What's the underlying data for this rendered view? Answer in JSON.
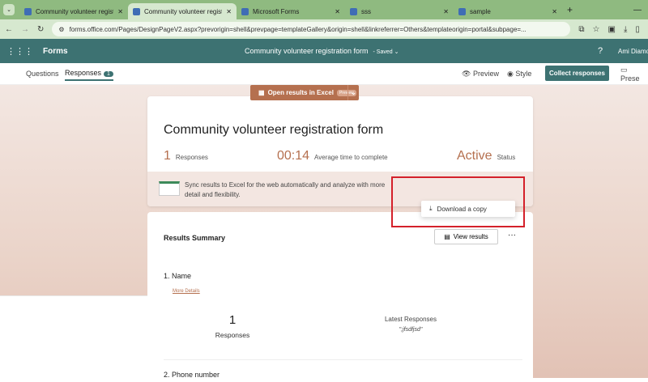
{
  "browser": {
    "tabs": [
      {
        "title": "Community volunteer registrati",
        "active": false
      },
      {
        "title": "Community volunteer registrati",
        "active": true
      },
      {
        "title": "Microsoft Forms",
        "active": false
      },
      {
        "title": "sss",
        "active": false
      },
      {
        "title": "sample",
        "active": false
      }
    ],
    "url": "forms.office.com/Pages/DesignPageV2.aspx?prevorigin=shell&prevpage=templateGallery&origin=shell&linkreferrer=Others&templateorigin=portal&subpage=..."
  },
  "app": {
    "name": "Forms",
    "form_title": "Community volunteer registration form",
    "saved": "Saved",
    "help": "?",
    "user": "Ami Diamo"
  },
  "subnav": {
    "questions": "Questions",
    "responses": "Responses",
    "responses_count": "1",
    "preview": "Preview",
    "style": "Style",
    "collect": "Collect responses",
    "present": "Prese"
  },
  "summary": {
    "title": "Community volunteer registration form",
    "responses_value": "1",
    "responses_label": "Responses",
    "avg_time_value": "00:14",
    "avg_time_label": "Average time to complete",
    "status_value": "Active",
    "status_label": "Status"
  },
  "excel": {
    "message": "Sync results to Excel for the web automatically and analyze with more detail and flexibility.",
    "open_button": "Open results in Excel",
    "preview_tag": "Preview",
    "menu_item": "Download a copy"
  },
  "results": {
    "heading": "Results Summary",
    "view_results": "View results",
    "more": "···",
    "questions": [
      {
        "label": "1.  Name",
        "more_details": "More Details",
        "count": "1",
        "count_label": "Responses",
        "latest_label": "Latest Responses",
        "latest_value": "\";jfsdfjsd\""
      },
      {
        "label": "2.  Phone number"
      }
    ]
  },
  "colors": {
    "accent": "#3d7272",
    "excel": "#b5704f",
    "highlight": "#d4202a"
  }
}
